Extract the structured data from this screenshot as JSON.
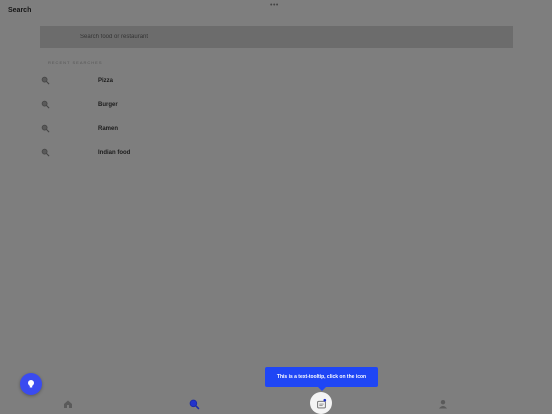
{
  "header": {
    "title": "Search",
    "more_icon": "more-dots-icon"
  },
  "search": {
    "placeholder": "Search food or restaurant",
    "value": ""
  },
  "recent": {
    "label": "RECENT SEARCHES",
    "items": [
      {
        "label": "Pizza",
        "icon": "search-icon"
      },
      {
        "label": "Burger",
        "icon": "search-icon"
      },
      {
        "label": "Ramen",
        "icon": "search-icon"
      },
      {
        "label": "Indian food",
        "icon": "search-icon"
      }
    ]
  },
  "fab": {
    "icon": "lightbulb-icon",
    "color": "#3a4bf0"
  },
  "tooltip": {
    "text": "This is a text-tooltip, click on the icon",
    "color": "#1f46f5"
  },
  "bottom_nav": {
    "items": [
      {
        "icon": "home-icon"
      },
      {
        "icon": "search-icon",
        "active": true
      },
      {
        "icon": "orders-icon",
        "highlighted": true
      },
      {
        "icon": "profile-icon"
      }
    ],
    "active_color": "#2233cc"
  }
}
